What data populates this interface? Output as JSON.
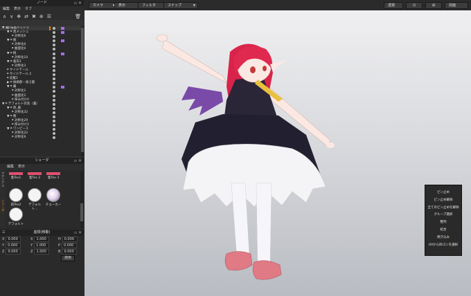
{
  "node_panel": {
    "title": "ノード",
    "menu": [
      "編集",
      "表示",
      "タブ"
    ],
    "toolbar": [
      "∧",
      "∨",
      "✥",
      "⇄",
      "✖",
      "⊕",
      "☰",
      "🗑"
    ],
    "tree": [
      {
        "indent": 0,
        "label": "▼ 🗓 描画メッシュ",
        "sel": true,
        "mk": true,
        "mk2": true
      },
      {
        "indent": 1,
        "label": "▼ ⌗ 黒メッシュ",
        "mk": true
      },
      {
        "indent": 2,
        "label": "⌗ 対称化6"
      },
      {
        "indent": 1,
        "label": "▼ ⌗ 腕",
        "mk": true
      },
      {
        "indent": 2,
        "label": "⌗ 対称化0"
      },
      {
        "indent": 2,
        "label": "⌗ 曲面化0"
      },
      {
        "indent": 1,
        "label": "▼ ⌗ 靴",
        "mk": true
      },
      {
        "indent": 2,
        "label": "⌗ 対称化10"
      },
      {
        "indent": 1,
        "label": "▼ ⌗ 着衣2"
      },
      {
        "indent": 2,
        "label": "⌗ 対称化3"
      },
      {
        "indent": 1,
        "label": "⌗ サイドテール"
      },
      {
        "indent": 1,
        "label": "⌗ サイドテール 2"
      },
      {
        "indent": 1,
        "label": "⌗ 前髪2"
      },
      {
        "indent": 1,
        "label": "▶ ⌗ 後頭部・後ろ髪"
      },
      {
        "indent": 1,
        "label": "▼ ⌗ 翼",
        "mk": true
      },
      {
        "indent": 2,
        "label": "⌗ 対称化1"
      },
      {
        "indent": 2,
        "label": "⌗ 曲面化2"
      },
      {
        "indent": 2,
        "label": "⌗ 厚み付け0"
      },
      {
        "indent": 0,
        "label": "▼ ⌗ デフォルト衣装（裏）"
      },
      {
        "indent": 1,
        "label": "▼ ⌗ 改_服"
      },
      {
        "indent": 2,
        "label": "⌗ 対称化32"
      },
      {
        "indent": 1,
        "label": "▼ ⌗ 腕"
      },
      {
        "indent": 2,
        "label": "⌗ 対称化29"
      },
      {
        "indent": 2,
        "label": "⌗ 厚み付け2"
      },
      {
        "indent": 1,
        "label": "▼ ⌗ ワンピース"
      },
      {
        "indent": 2,
        "label": "⌗ 対称化22"
      },
      {
        "indent": 2,
        "label": "⌗ 対称化9"
      }
    ]
  },
  "shader_panel": {
    "title": "シェーダ",
    "menu": [
      "編集",
      "表示"
    ],
    "side_tabs": [
      "マテリアル",
      "シェーダ"
    ],
    "thumbs": [
      {
        "label": "着Tex1",
        "style": "w"
      },
      {
        "label": "着Tex 2",
        "style": "w"
      },
      {
        "label": "着Tex 3",
        "style": "d"
      },
      {
        "label": "肌Tex2",
        "style": "w"
      },
      {
        "label": "デフォルト…",
        "style": "w"
      },
      {
        "label": "チョーカー",
        "style": "p"
      },
      {
        "label": "デフォルト",
        "style": "w"
      }
    ]
  },
  "transform_panel": {
    "title": "座標(移動)",
    "rows": [
      {
        "a": "X",
        "v1": "0.000",
        "b": "X",
        "v2": "1.000",
        "c": "H",
        "v3": "0.000"
      },
      {
        "a": "Y",
        "v1": "0.000",
        "b": "Y",
        "v2": "1.000",
        "c": "P",
        "v3": "0.000"
      },
      {
        "a": "Z",
        "v1": "0.000",
        "b": "Z",
        "v2": "1.000",
        "c": "B",
        "v3": "0.000"
      }
    ],
    "apply": "適用"
  },
  "topbar": {
    "left": [
      "カメラ",
      "表示",
      "フィルタ",
      "スナップ"
    ],
    "right": [
      "透視",
      "⊡",
      "⊞",
      "前面"
    ]
  },
  "context_menu": [
    "ピン止め",
    "ピン止め解除",
    "全てのピン止めを解除",
    "グループ選択",
    "整列",
    "結合",
    "焼き込み",
    "UVから四ゴンを選択"
  ]
}
